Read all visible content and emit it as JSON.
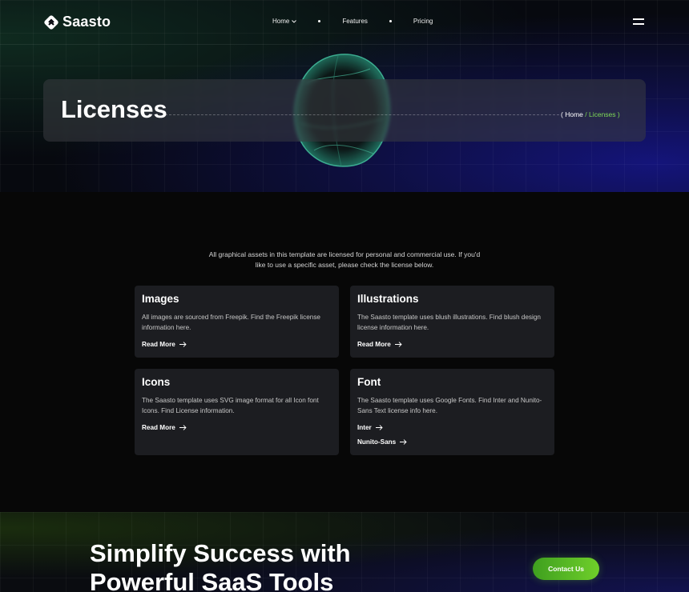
{
  "brand": {
    "name": "Saasto",
    "accent": "#7ed957"
  },
  "nav": {
    "items": [
      {
        "label": "Home",
        "has_dropdown": true
      },
      {
        "label": "Features"
      },
      {
        "label": "Pricing"
      }
    ]
  },
  "page_header": {
    "title": "Licenses",
    "breadcrumb": {
      "open": "( ",
      "home": "Home",
      "sep": " / ",
      "current": "Licenses",
      "close": " )"
    }
  },
  "intro": "All graphical assets in this template are licensed for personal and commercial use. If you'd like to use a specific asset, please check the license below.",
  "cards": [
    {
      "title": "Images",
      "desc": "All images are sourced from Freepik. Find the Freepik license information here.",
      "links": [
        "Read More"
      ]
    },
    {
      "title": "Illustrations",
      "desc": "The Saasto template uses blush illustrations. Find blush design license information here.",
      "links": [
        "Read More"
      ]
    },
    {
      "title": "Icons",
      "desc": "The Saasto template uses SVG image format for all Icon font Icons. Find License information.",
      "links": [
        "Read More"
      ]
    },
    {
      "title": "Font",
      "desc": "The Saasto template uses Google Fonts. Find Inter and Nunito-Sans Text license info here.",
      "links": [
        "Inter",
        "Nunito-Sans"
      ]
    }
  ],
  "cta": {
    "heading_line1": "Simplify Success with",
    "heading_line2": "Powerful SaaS Tools",
    "button": "Contact Us"
  }
}
